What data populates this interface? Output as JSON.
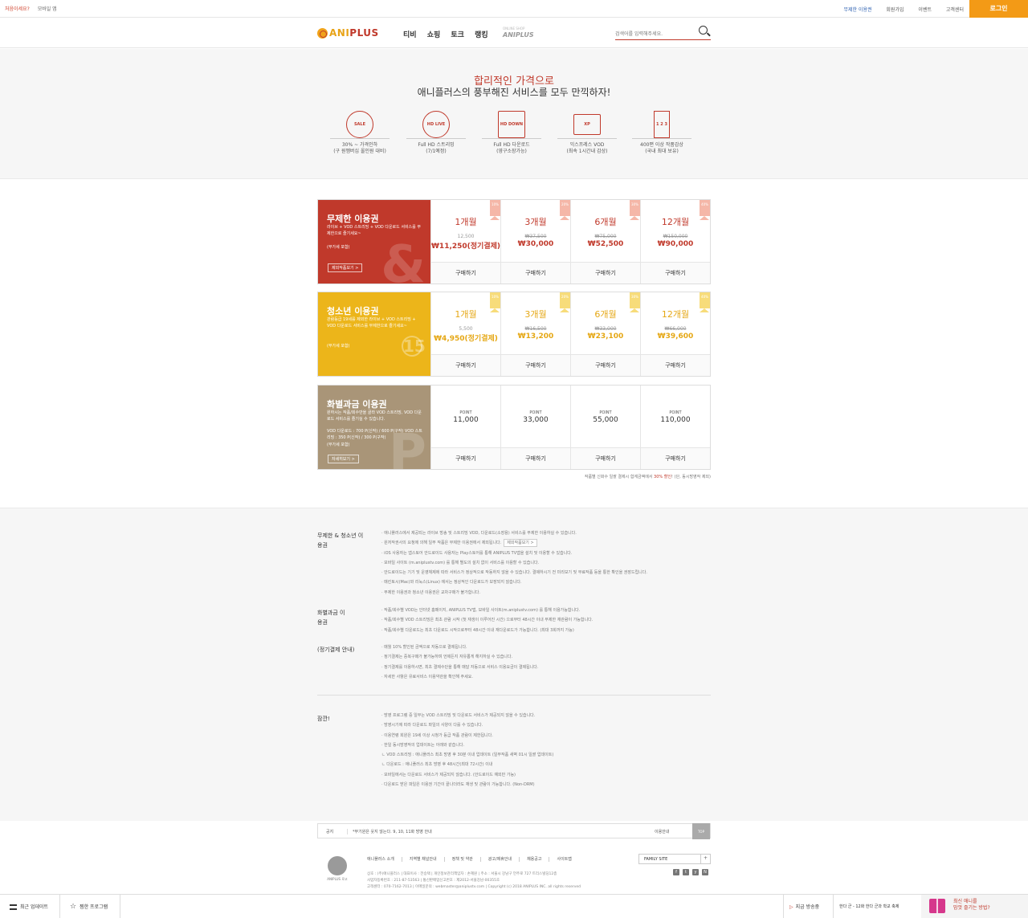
{
  "util": {
    "left_links": [
      "처음이세요?",
      "모바일 앱"
    ],
    "right_links": [
      "무제한 이용권",
      "회원가입",
      "이벤트",
      "고객센터"
    ],
    "login_label": "로그인"
  },
  "header": {
    "logo_prefix": "ANI",
    "logo_suffix": "PLUS",
    "nav": [
      "티비",
      "쇼핑",
      "토크",
      "랭킹"
    ],
    "shop_small": "ONLINE SHOP",
    "shop_label": "ANIPLUS",
    "search_placeholder": "검색어를 입력해주세요."
  },
  "banner": {
    "title_red": "합리적인 가격으로",
    "title_dark": "애니플러스의 풍부해진 서비스를 모두 만끽하자!",
    "features": [
      {
        "icon": "SALE",
        "cap1": "30% ~ 가격인하",
        "cap2": "(구 원멤버십 올인원 대비)"
      },
      {
        "icon": "HD LIVE",
        "cap1": "Full HD 스트리밍",
        "cap2": "(7/1예정)"
      },
      {
        "icon": "HD DOWN",
        "cap1": "Full HD 다운로드",
        "cap2": "(영구소장가능)"
      },
      {
        "icon": "XP",
        "cap1": "익스프레스 VOD",
        "cap2": "(최속 1시간내 감상)"
      },
      {
        "icon": "1 2 3",
        "cap1": "400편 이상 작품감상",
        "cap2": "(국내 최대 보유)"
      }
    ]
  },
  "plans": [
    {
      "name": "무제한 이용권",
      "color": "#c0392b",
      "desc": "라이브 + VOD 스트리밍 + VOD 다운로드 서비스를 무제한으로 즐기세요~",
      "vat": "(부가세 포함)",
      "more": "제외작품보기 >",
      "deco": "&",
      "items": [
        {
          "tag": "10%",
          "month": "1개월",
          "orig": "12,500",
          "price": "₩11,250(정기결제)",
          "buy": "구매하기"
        },
        {
          "tag": "20%",
          "month": "3개월",
          "orig": "₩37,500",
          "price": "₩30,000",
          "buy": "구매하기"
        },
        {
          "tag": "30%",
          "month": "6개월",
          "orig": "₩75,000",
          "price": "₩52,500",
          "buy": "구매하기"
        },
        {
          "tag": "40%",
          "month": "12개월",
          "orig": "₩150,000",
          "price": "₩90,000",
          "buy": "구매하기"
        }
      ]
    },
    {
      "name": "청소년 이용권",
      "color": "#ecb51a",
      "desc": "관람등급 19세를 제외한 라이브 + VOD 스트리밍 + VOD 다운로드 서비스를 무제한으로 즐기세요~",
      "vat": "(부가세 포함)",
      "more": "",
      "deco": "15",
      "items": [
        {
          "tag": "10%",
          "month": "1개월",
          "orig": "5,500",
          "price": "₩4,950(정기결제)",
          "buy": "구매하기"
        },
        {
          "tag": "20%",
          "month": "3개월",
          "orig": "₩16,500",
          "price": "₩13,200",
          "buy": "구매하기"
        },
        {
          "tag": "30%",
          "month": "6개월",
          "orig": "₩33,000",
          "price": "₩23,100",
          "buy": "구매하기"
        },
        {
          "tag": "40%",
          "month": "12개월",
          "orig": "₩66,000",
          "price": "₩39,600",
          "buy": "구매하기"
        }
      ]
    },
    {
      "name": "화별과금 이용권",
      "color": "#a99578",
      "desc": "원하시는 작품/회수만을 골라 VOD 스트리밍, VOD 다운로드 서비스를 즐기실 수 있습니다.",
      "desc2": "VOD 다운로드 : 700 P(신작) / 600 P(구작) VOD 스트리밍 : 350 P(신작) / 300 P(구작)",
      "vat": "(부가세 포함)",
      "more": "자세히보기 >",
      "deco": "P",
      "items": [
        {
          "pt": "POINT",
          "value": "11,000",
          "buy": "구매하기"
        },
        {
          "pt": "POINT",
          "value": "33,000",
          "buy": "구매하기"
        },
        {
          "pt": "POINT",
          "value": "55,000",
          "buy": "구매하기"
        },
        {
          "pt": "POINT",
          "value": "110,000",
          "buy": "구매하기"
        }
      ]
    }
  ],
  "note": {
    "pre": "작품별 신화수 일괄 결제시 합계금액에서 ",
    "hl": "30% 할인",
    "post": "! (단, 동시방영작 제외)"
  },
  "info": {
    "s1_title": "무제한 & 청소년 이용권",
    "s1_items": [
      "· 애니플러스에서 제공되는 라이브 방송 및 스트리밍 VOD, 다운로드(소장용) 서비스를 무제한 이용하실 수 있습니다.",
      "· 원저작권사의 요청에 의해 일부 작품은 무제한 이용권에서 제외됩니다.",
      "· iOS 사용자는 앱스토어 안드로이드 사용자는 Play스토어를 통해 ANIPLUS TV앱을 설치 및 이용할 수 있습니다.",
      "· 모바일 사이트 (m.aniplustv.com) 를 통해 별도의 설치 없이 서비스를 이용할 수 있습니다.",
      "· 안드로이드는 기기 및 운영체제에 따라 서비스가 정상적으로 작동하지 않을 수 있습니다. 결제하시기 전 미리보기 및 무료작품 등을 통한 확인을 권장드립니다.",
      "· 매킨토시(Mac)와 리눅스(Linux) 에서는 정상적인 다운로드가 보장되지 않습니다.",
      "· 무제한 이용권과 청소년 이용권은 교차구매가 불가합니다."
    ],
    "s1_btn": "제외작품보기 >",
    "s2_title": "화별과금 이용권",
    "s2_items": [
      "· 작품/회수별 VOD는 인터넷 홈페이지, ANIPLUS TV앱, 모바일 사이트(m.aniplustv.com) 를 통해 이용가능합니다.",
      "· 작품/회수별 VOD 스트리밍은 최초 관람 시작 (첫 재생이 이루어진 시간) 으로부터 48시간 이내 무제한 재관람이 가능합니다.",
      "· 작품/회수별 다운로드는 최초 다운로드 시작으로부터 48시간 이내 재다운로드가 가능합니다. (최대 3회까지 가능)"
    ],
    "s3_title": "(정기결제 안내)",
    "s3_items": [
      "· 매월 10% 할인된 금액으로 자동으로 결제됩니다.",
      "· 정기결제는 중복구매가 불가능하며 언제든지 자유롭게 해지하실 수 있습니다.",
      "· 정기결제를 이용하시면, 최초 결제수단을 통해 매달 자동으로 서비스 이용요금이 결제됩니다.",
      "· 자세한 사항은 유료서비스 이용약관을 확인해 주세요."
    ],
    "s4_title": "잠깐!",
    "s4_items": [
      "· 방영 프로그램 중 일부는 VOD 스트리밍 및 다운로드 서비스가 제공되지 않을 수 있습니다.",
      "· 방영시기에 따라 다운로드 파일의 사양이 다를 수 있습니다.",
      "· 이용연령 회원은 19세 이상 시청가 등급 작품 관람이 제한됩니다.",
      "· 한일 동시방영작의 업데이트는 아래와 같습니다.",
      "   ㄴ VOD 스트리밍 : 애니플러스 최초 방영 후 30분 이내 업데이트 (일부작품 새벽 01시 일괄 업데이트)",
      "   ㄴ 다운로드 : 애니플러스 최초 방영 후 48시간(최대 72시간) 이내",
      "· 모바일에서는 다운로드 서비스가 제공되지 않습니다. (안드로이드 예외만 가능)",
      "· 다운로드 받은 파일은 이용권 기간이 끝나더라도 재생 및 관람이 가능합니다. (Non-DRM)"
    ]
  },
  "notice": {
    "label": "공지",
    "text": "*부기원은 웃지 않는다. 9, 10, 11화 방영 안내",
    "more": "이용안내",
    "top": "TOP"
  },
  "footer": {
    "logo_sub": "ANIPLUS 로고",
    "links": [
      "애니플러스 소개",
      "지역별 채널안내",
      "정책 및 약관",
      "광고/제휴안내",
      "채용공고",
      "사이트맵"
    ],
    "info1": "상호 : (주)애니플러스 | 대표이사 : 전승택 | 개인정보관리책임자 : 손혜원 | 주소 : 서울시 강남구 언주로 727 트리스빌딩12층",
    "info2": "사업자등록번호 : 211-87-53563 | 통신판매업신고번호 : 제2012-서울강남-00355호",
    "info3": "고객센터 : 070-7162-7013 | 이메일문의 : webmaster@aniplustv.com | Copyright (c) 2018 ANIPLUS INC. all rights reserved",
    "family": "FAMILY SITE",
    "social": [
      "f",
      "t",
      "y",
      "N"
    ]
  },
  "bottom": {
    "item1": "최근 업데이트",
    "item2": "찜한 프로그램",
    "item3": "지금 방송중",
    "item4": "한다 군 - 12화 한다 군과 학교 축제",
    "gift1": "최신 애니를",
    "gift2": "맘껏 즐기는 방법?"
  },
  "colors": {
    "accent": "#c0392b",
    "login": "#f39a16",
    "youth": "#ecb51a",
    "point": "#a99578"
  }
}
